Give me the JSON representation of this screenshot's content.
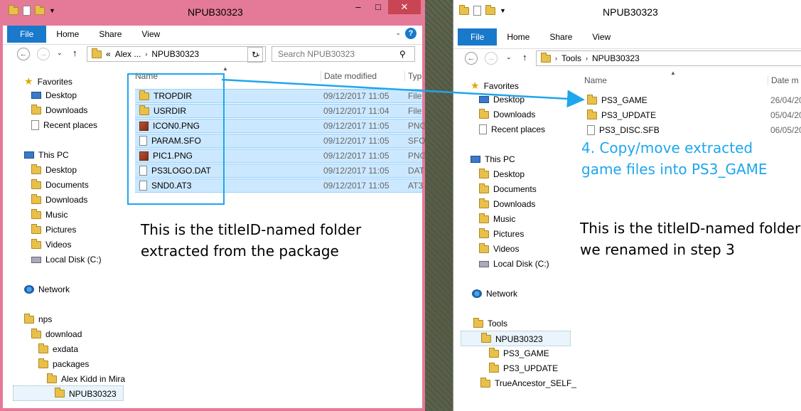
{
  "left": {
    "title": "NPUB30323",
    "tabs": [
      "File",
      "Home",
      "Share",
      "View"
    ],
    "breadcrumb": [
      "«",
      "Alex ...",
      "NPUB30323"
    ],
    "search_placeholder": "Search NPUB30323",
    "columns": {
      "name": "Name",
      "date": "Date modified",
      "type": "Typ"
    },
    "nav": {
      "favorites": "Favorites",
      "desktop": "Desktop",
      "downloads": "Downloads",
      "recent": "Recent places",
      "thispc": "This PC",
      "pc_desktop": "Desktop",
      "documents": "Documents",
      "pc_downloads": "Downloads",
      "music": "Music",
      "pictures": "Pictures",
      "videos": "Videos",
      "localdisk": "Local Disk (C:)",
      "network": "Network",
      "nps": "nps",
      "download": "download",
      "exdata": "exdata",
      "packages": "packages",
      "alexkidd": "Alex Kidd in Mira",
      "npub": "NPUB30323"
    },
    "files": [
      {
        "name": "TROPDIR",
        "date": "09/12/2017 11:05",
        "type": "File",
        "icon": "folder-icon"
      },
      {
        "name": "USRDIR",
        "date": "09/12/2017 11:04",
        "type": "File",
        "icon": "folder-icon"
      },
      {
        "name": "ICON0.PNG",
        "date": "09/12/2017 11:05",
        "type": "PNG",
        "icon": "image-icon"
      },
      {
        "name": "PARAM.SFO",
        "date": "09/12/2017 11:05",
        "type": "SFO",
        "icon": "file-icon"
      },
      {
        "name": "PIC1.PNG",
        "date": "09/12/2017 11:05",
        "type": "PNG",
        "icon": "image-icon"
      },
      {
        "name": "PS3LOGO.DAT",
        "date": "09/12/2017 11:05",
        "type": "DAT",
        "icon": "file-icon"
      },
      {
        "name": "SND0.AT3",
        "date": "09/12/2017 11:05",
        "type": "AT3",
        "icon": "file-icon"
      }
    ],
    "annotation_line1": "This is the titleID-named folder",
    "annotation_line2": "extracted from the package"
  },
  "right": {
    "title": "NPUB30323",
    "tabs": [
      "File",
      "Home",
      "Share",
      "View"
    ],
    "breadcrumb": [
      "Tools",
      "NPUB30323"
    ],
    "columns": {
      "name": "Name",
      "date": "Date m"
    },
    "nav": {
      "favorites": "Favorites",
      "desktop": "Desktop",
      "downloads": "Downloads",
      "recent": "Recent places",
      "thispc": "This PC",
      "pc_desktop": "Desktop",
      "documents": "Documents",
      "pc_downloads": "Downloads",
      "music": "Music",
      "pictures": "Pictures",
      "videos": "Videos",
      "localdisk": "Local Disk (C:)",
      "network": "Network",
      "tools": "Tools",
      "npub": "NPUB30323",
      "ps3game": "PS3_GAME",
      "ps3update": "PS3_UPDATE",
      "trueancestor": "TrueAncestor_SELF_"
    },
    "files": [
      {
        "name": "PS3_GAME",
        "date": "26/04/20",
        "icon": "folder-icon"
      },
      {
        "name": "PS3_UPDATE",
        "date": "05/04/20",
        "icon": "folder-icon"
      },
      {
        "name": "PS3_DISC.SFB",
        "date": "06/05/20",
        "icon": "file-icon"
      }
    ],
    "step_line1": "4. Copy/move extracted",
    "step_line2": "game files into PS3_GAME",
    "annotation_line1": "This is the titleID-named folder",
    "annotation_line2": "we renamed in step 3"
  },
  "colors": {
    "accent": "#1ea6ee",
    "file_tab": "#1979ca",
    "left_frame": "#e57a98",
    "selection": "#cce8ff"
  }
}
